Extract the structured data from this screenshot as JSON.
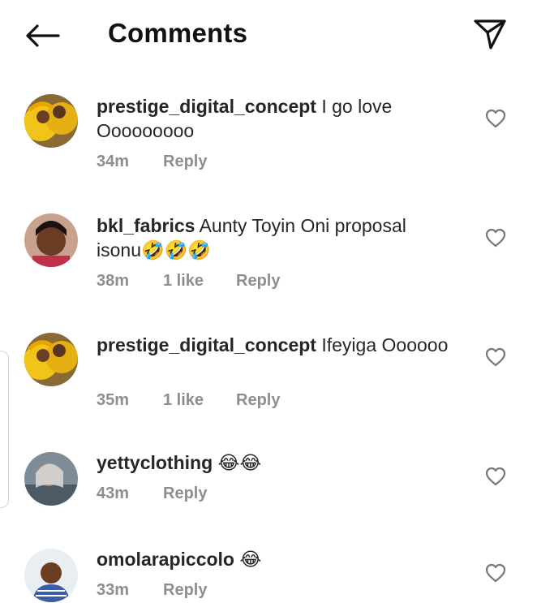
{
  "header": {
    "title": "Comments",
    "back_icon": "arrow-left-icon",
    "share_icon": "paper-plane-icon"
  },
  "comments": [
    {
      "username": "prestige_digital_concept",
      "text": "I go love Ooooooooo",
      "time": "34m",
      "likes": "",
      "reply": "Reply"
    },
    {
      "username": "bkl_fabrics",
      "text": "Aunty Toyin Oni proposal isonu🤣🤣🤣",
      "time": "38m",
      "likes": "1 like",
      "reply": "Reply"
    },
    {
      "username": "prestige_digital_concept",
      "text": "Ifeyiga Oooooo",
      "time": "35m",
      "likes": "1 like",
      "reply": "Reply"
    },
    {
      "username": "yettyclothing",
      "text": "😂😂",
      "time": "43m",
      "likes": "",
      "reply": "Reply"
    },
    {
      "username": "omolarapiccolo",
      "text": "😂",
      "time": "33m",
      "likes": "",
      "reply": "Reply"
    }
  ],
  "colors": {
    "text": "#262626",
    "meta": "#8e8e8e",
    "background": "#ffffff"
  }
}
